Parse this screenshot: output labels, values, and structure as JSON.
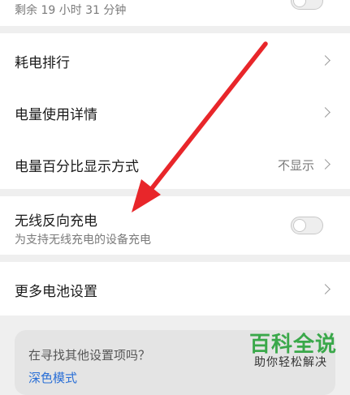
{
  "top_item": {
    "subtitle": "剩余 19 小时 31 分钟"
  },
  "rows": [
    {
      "label": "耗电排行"
    },
    {
      "label": "电量使用详情"
    },
    {
      "label": "电量百分比显示方式",
      "value": "不显示"
    }
  ],
  "reverse_charging": {
    "label": "无线反向充电",
    "subtitle": "为支持无线充电的设备充电",
    "enabled": false
  },
  "more_battery": {
    "label": "更多电池设置"
  },
  "help": {
    "title": "在寻找其他设置项吗？",
    "link": "深色模式"
  },
  "watermark": {
    "main": "百科全说",
    "sub": "助你轻松解决"
  },
  "colors": {
    "annotation_arrow": "#e8262a",
    "watermark_green": "#3aa84a",
    "link_blue": "#2a6fd6"
  }
}
